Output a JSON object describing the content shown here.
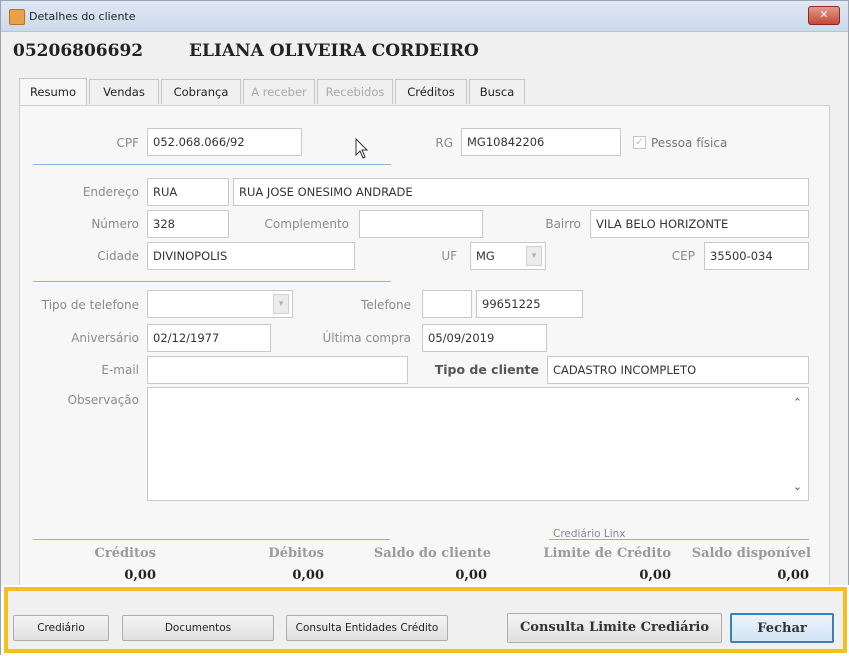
{
  "window": {
    "title": "Detalhes do cliente",
    "close_label": "✕"
  },
  "header": {
    "code": "05206806692",
    "name": "ELIANA OLIVEIRA CORDEIRO"
  },
  "tabs": [
    {
      "label": "Resumo",
      "active": true,
      "disabled": false
    },
    {
      "label": "Vendas",
      "active": false,
      "disabled": false
    },
    {
      "label": "Cobrança",
      "active": false,
      "disabled": false
    },
    {
      "label": "A receber",
      "active": false,
      "disabled": true
    },
    {
      "label": "Recebidos",
      "active": false,
      "disabled": true
    },
    {
      "label": "Créditos",
      "active": false,
      "disabled": false
    },
    {
      "label": "Busca",
      "active": false,
      "disabled": false
    }
  ],
  "form": {
    "cpf_label": "CPF",
    "cpf": "052.068.066/92",
    "rg_label": "RG",
    "rg": "MG10842206",
    "pessoa_fisica_label": "Pessoa física",
    "pessoa_fisica": true,
    "endereco_label": "Endereço",
    "endereco_tipo": "RUA",
    "endereco": "RUA JOSE ONESIMO ANDRADE",
    "numero_label": "Número",
    "numero": "328",
    "complemento_label": "Complemento",
    "complemento": "",
    "bairro_label": "Bairro",
    "bairro": "VILA BELO HORIZONTE",
    "cidade_label": "Cidade",
    "cidade": "DIVINOPOLIS",
    "uf_label": "UF",
    "uf": "MG",
    "cep_label": "CEP",
    "cep": "35500-034",
    "tipo_telefone_label": "Tipo de telefone",
    "tipo_telefone": "",
    "telefone_label": "Telefone",
    "telefone_ddd": "",
    "telefone": "99651225",
    "aniversario_label": "Aniversário",
    "aniversario": "02/12/1977",
    "ultima_compra_label": "Última compra",
    "ultima_compra": "05/09/2019",
    "email_label": "E-mail",
    "email": "",
    "tipo_cliente_label": "Tipo de cliente",
    "tipo_cliente": "CADASTRO INCOMPLETO",
    "observacao_label": "Observação",
    "observacao": ""
  },
  "summary": {
    "crediario_label": "Crediário Linx",
    "creditos_label": "Créditos",
    "creditos": "0,00",
    "debitos_label": "Débitos",
    "debitos": "0,00",
    "saldo_label": "Saldo do cliente",
    "saldo": "0,00",
    "limite_label": "Limite de Crédito",
    "limite": "0,00",
    "disponivel_label": "Saldo disponível",
    "disponivel": "0,00"
  },
  "buttons": {
    "crediario": "Crediário",
    "documentos": "Documentos",
    "consulta_entidades": "Consulta Entidades Crédito",
    "consulta_limite": "Consulta Limite Crediário",
    "fechar": "Fechar"
  },
  "colors": {
    "highlight": "#f6bf1e",
    "separator": "#8fb2d6",
    "primary_border": "#3c7fb1"
  }
}
